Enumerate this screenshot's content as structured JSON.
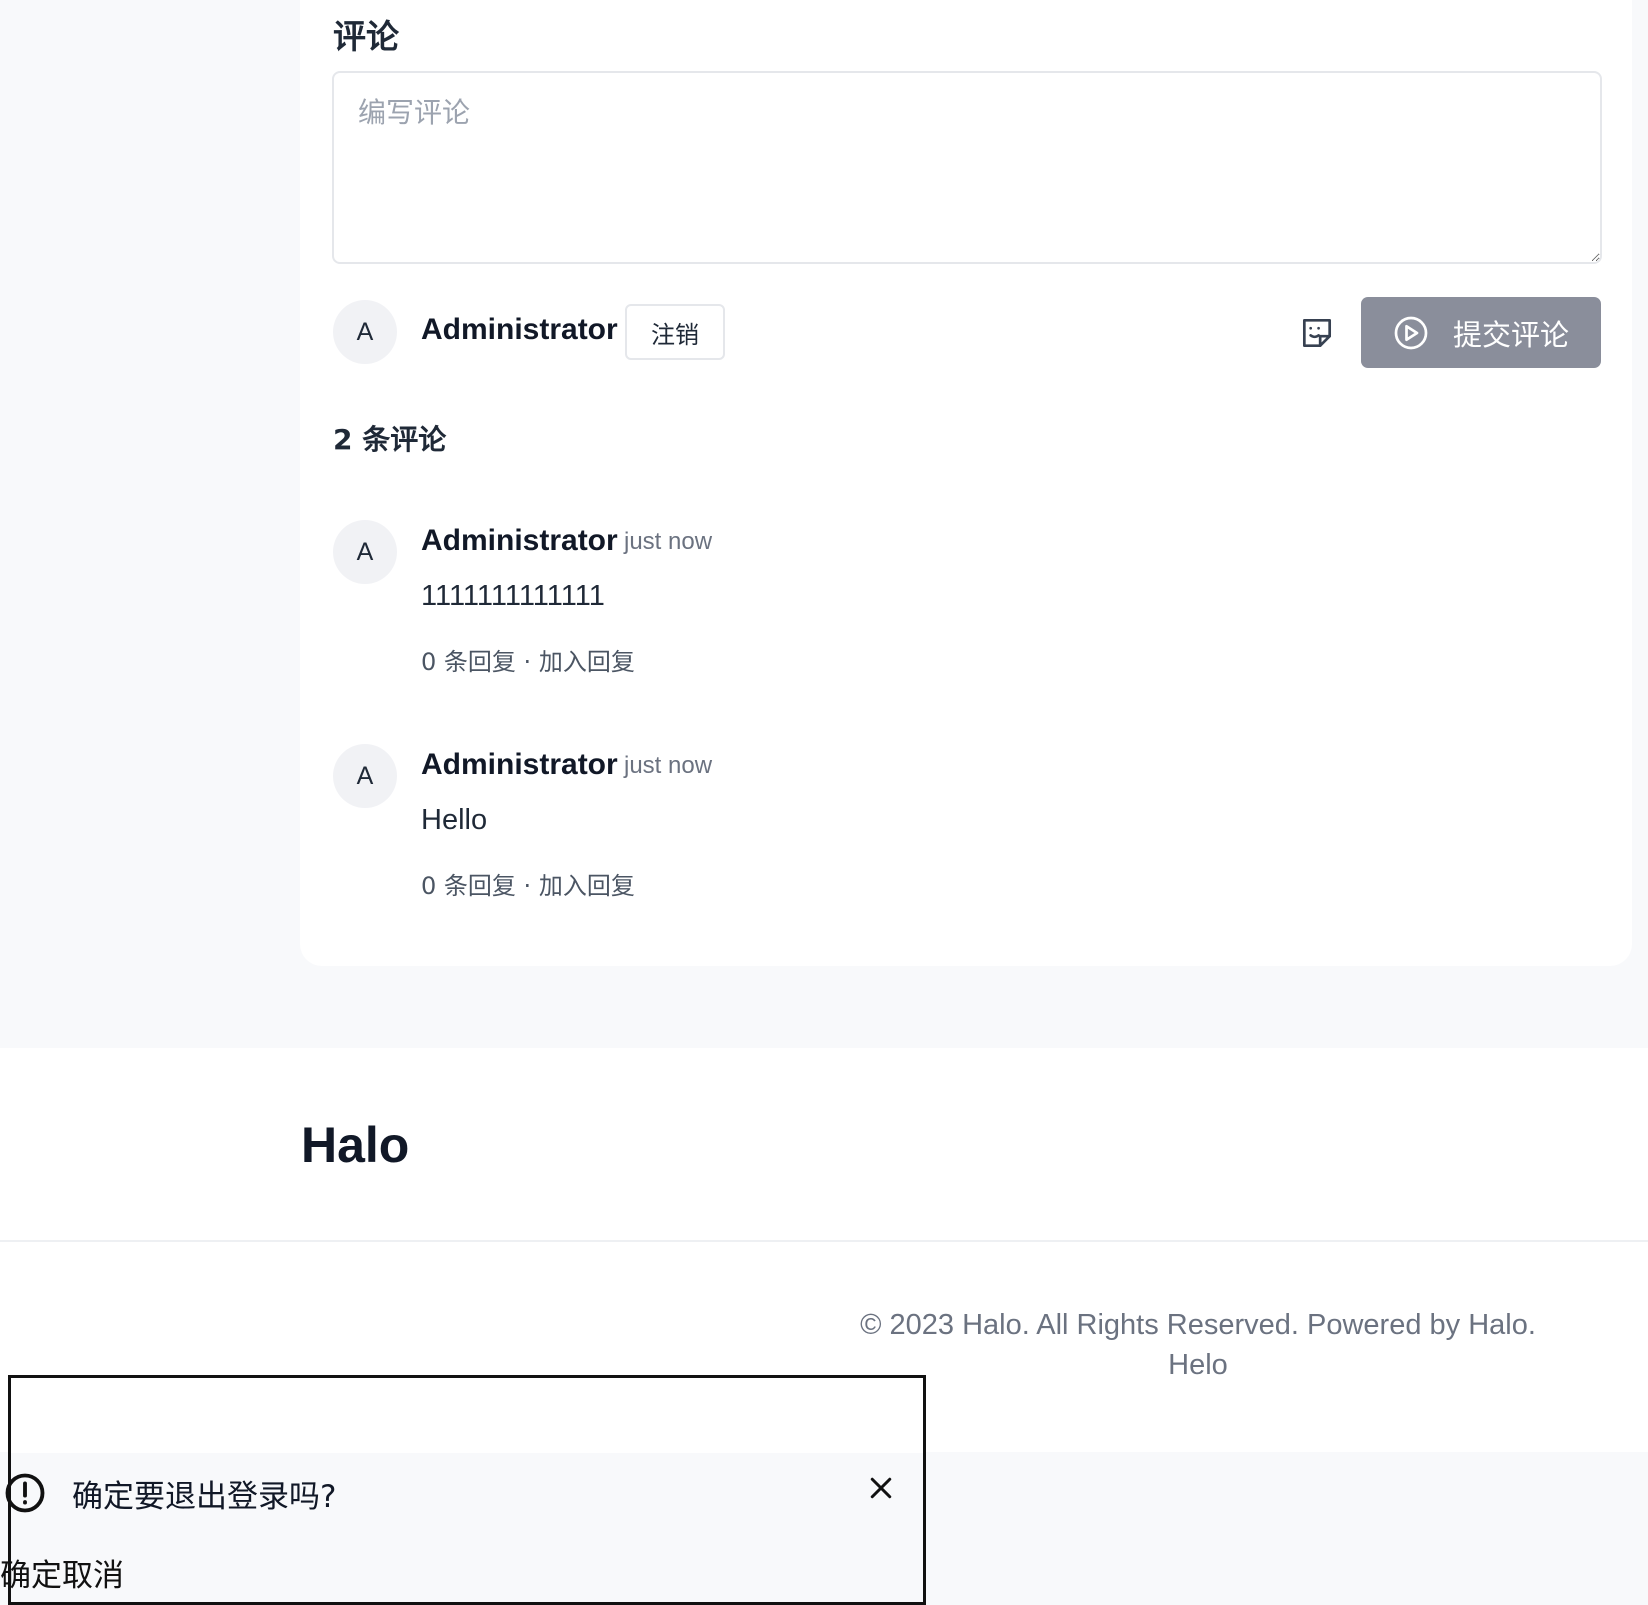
{
  "comments_section": {
    "title": "评论",
    "textarea_placeholder": "编写评论",
    "current_user": {
      "avatar_initial": "A",
      "name": "Administrator",
      "logout_label": "注销"
    },
    "emoji_icon": "sticker-smile-icon",
    "submit_icon": "send-circle-icon",
    "submit_label": "提交评论",
    "count_label": "2 条评论",
    "comments": [
      {
        "avatar_initial": "A",
        "author": "Administrator",
        "time": "just now",
        "content": "1111111111111",
        "reply_count": "0 条回复",
        "separator": "·",
        "add_reply": "加入回复"
      },
      {
        "avatar_initial": "A",
        "author": "Administrator",
        "time": "just now",
        "content": "Hello",
        "reply_count": "0 条回复",
        "separator": "·",
        "add_reply": "加入回复"
      }
    ]
  },
  "footer": {
    "brand": "Halo",
    "copyright_line1": "© 2023 Halo. All Rights Reserved. Powered by Halo.",
    "copyright_line2": "Helo"
  },
  "dialog": {
    "icon": "exclamation-circle-icon",
    "title": "确定要退出登录吗?",
    "close_icon": "close-icon",
    "confirm_label": "确定",
    "cancel_label": "取消"
  },
  "colors": {
    "page_background": "#f8f9fb",
    "card_background": "#ffffff",
    "submit_button": "#8a8e9b",
    "muted_text": "#6b7280",
    "avatar_background": "#f1f2f5"
  }
}
